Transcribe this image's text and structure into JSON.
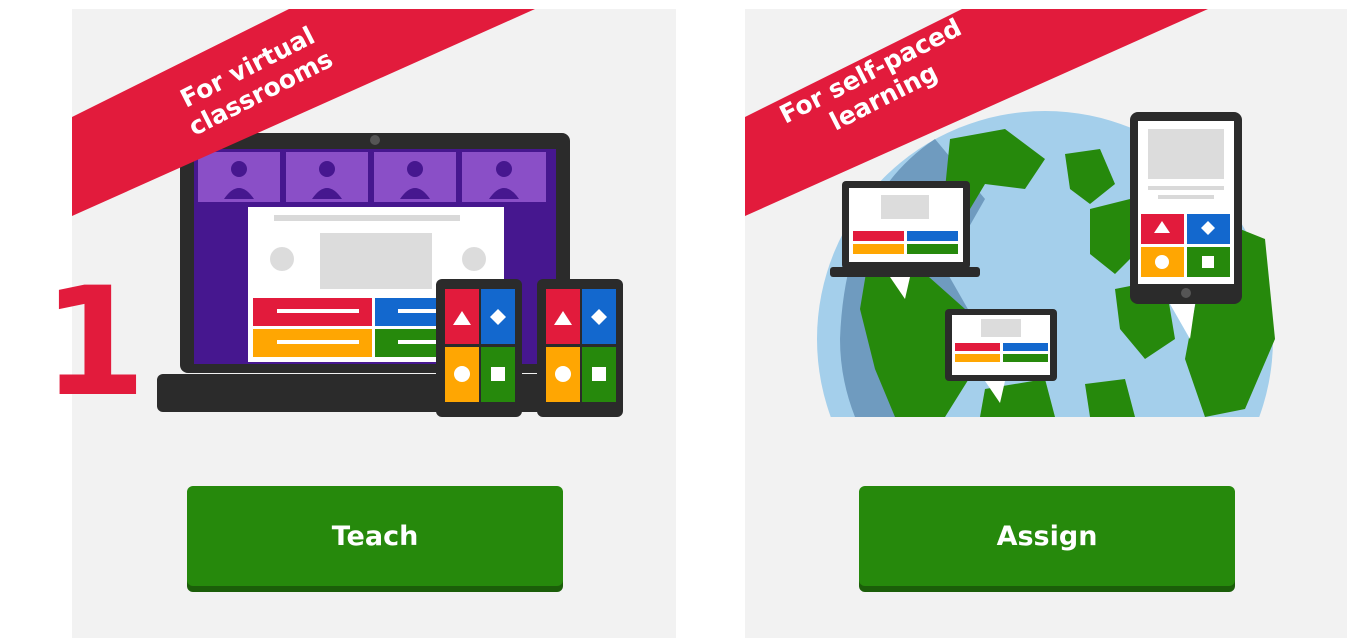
{
  "cards": [
    {
      "ribbon": [
        "For virtual",
        "classrooms"
      ],
      "button_label": "Teach"
    },
    {
      "ribbon": [
        "For self-paced",
        "learning"
      ],
      "button_label": "Assign"
    }
  ],
  "step_number": "1",
  "colors": {
    "ribbon": "#e21b3c",
    "button": "#26890c",
    "answer_red": "#e21b3c",
    "answer_blue": "#1368ce",
    "answer_yellow": "#ffa602",
    "answer_green": "#26890c",
    "laptop_purple": "#46178f"
  }
}
